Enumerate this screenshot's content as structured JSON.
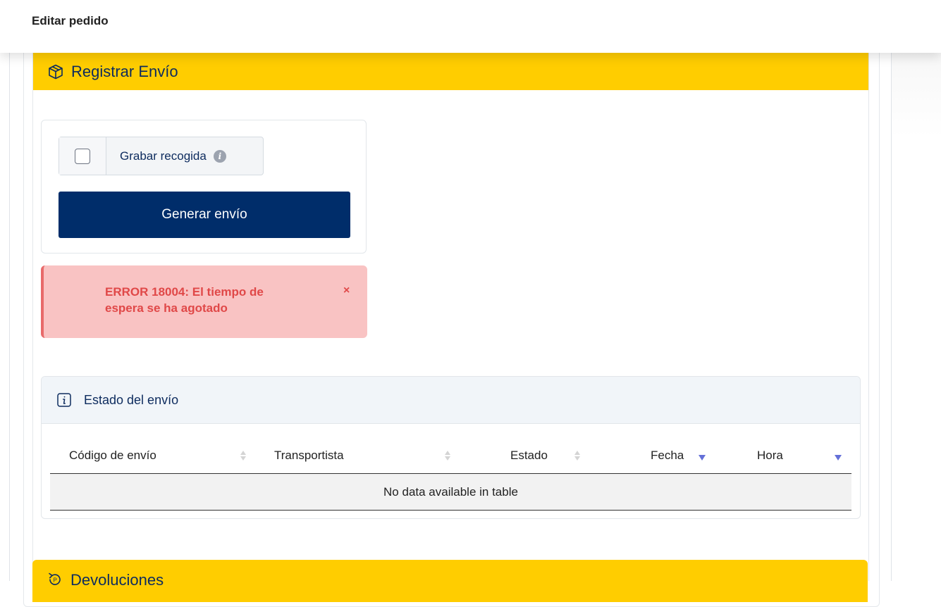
{
  "header": {
    "title": "Editar pedido"
  },
  "shipment_section": {
    "title": "Registrar Envío",
    "icon": "package-icon",
    "pickup_checkbox": {
      "label": "Grabar recogida",
      "checked": false,
      "info_icon": "info-icon"
    },
    "generate_button": "Generar envío"
  },
  "alert": {
    "message": "ERROR 18004: El tiempo de espera se ha agotado",
    "close": "×",
    "color": "#e04848",
    "background": "#f9c3c3"
  },
  "status_panel": {
    "title": "Estado del envío",
    "icon": "info-icon",
    "columns": [
      "Código de envío",
      "Transportista",
      "Estado",
      "Fecha",
      "Hora"
    ],
    "empty_text": "No data available in table"
  },
  "returns_section": {
    "title": "Devoluciones",
    "icon": "return-icon"
  },
  "colors": {
    "accent": "#ffcd00",
    "primary": "#002d6a"
  }
}
